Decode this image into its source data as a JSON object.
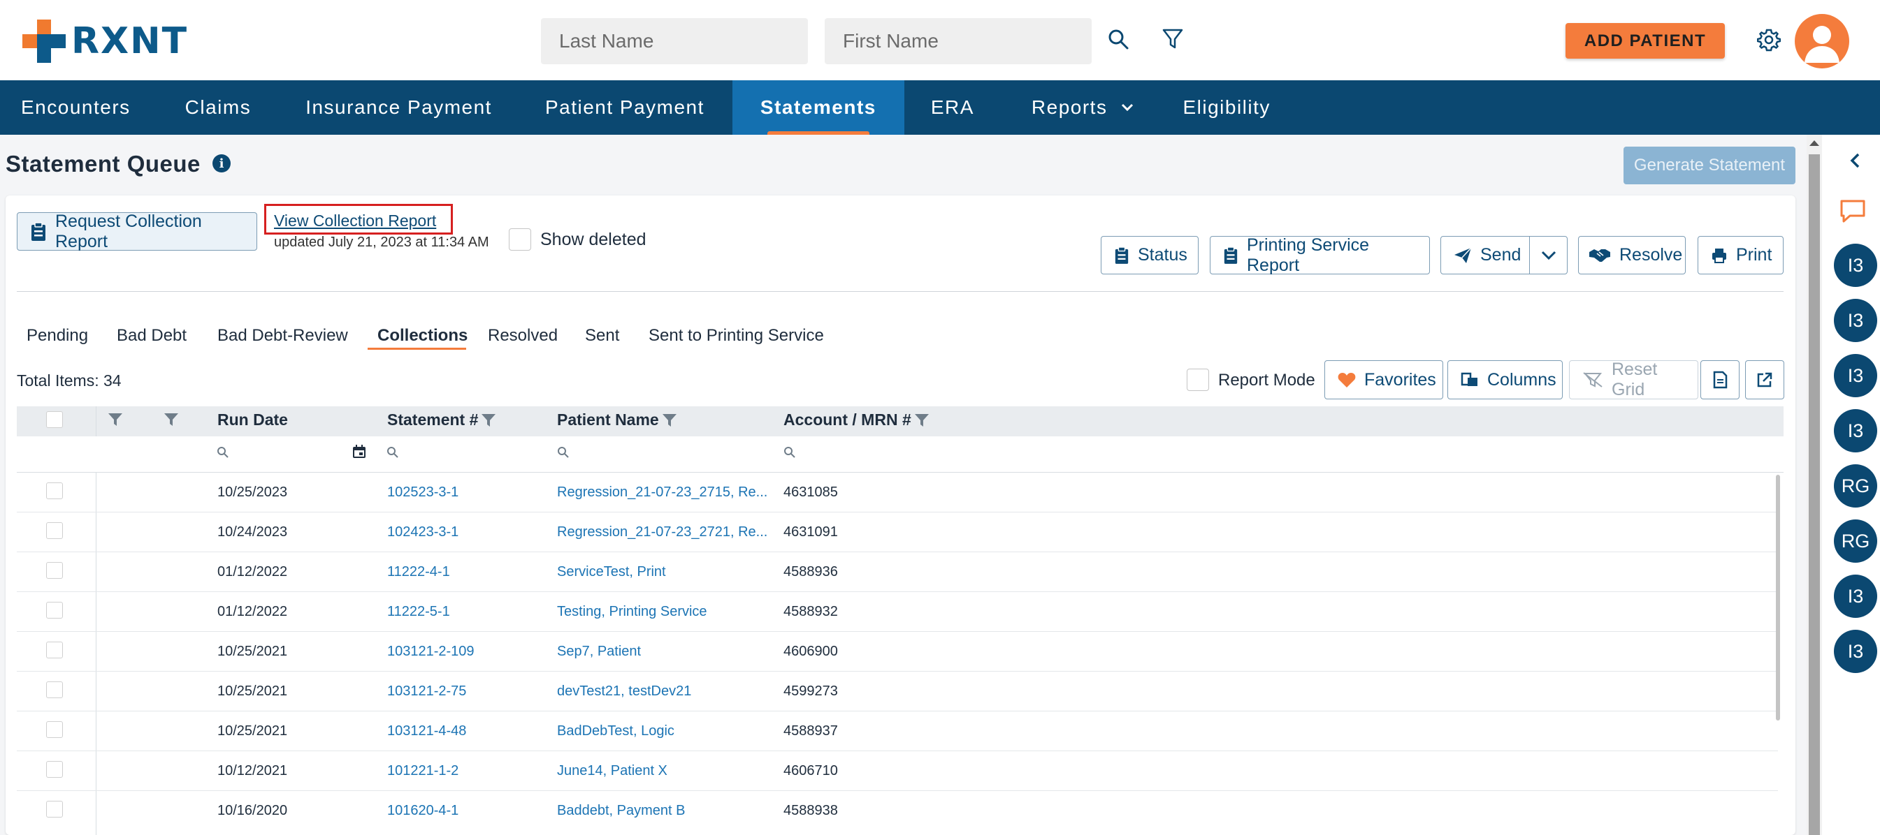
{
  "header": {
    "logo_text": "RXNT",
    "last_name_placeholder": "Last Name",
    "first_name_placeholder": "First Name",
    "add_patient": "ADD PATIENT"
  },
  "nav": {
    "items": [
      "Encounters",
      "Claims",
      "Insurance Payment",
      "Patient Payment",
      "Statements",
      "ERA",
      "Reports",
      "Eligibility"
    ],
    "active": "Statements"
  },
  "page": {
    "title": "Statement Queue",
    "generate_button": "Generate Statement"
  },
  "toolbar": {
    "request_collection": "Request Collection Report",
    "view_collection": "View Collection Report",
    "updated": "updated July 21, 2023 at 11:34 AM",
    "show_deleted": "Show deleted",
    "status": "Status",
    "printing_service_report": "Printing Service Report",
    "send": "Send",
    "resolve": "Resolve",
    "print": "Print"
  },
  "tabs": [
    "Pending",
    "Bad Debt",
    "Bad Debt-Review",
    "Collections",
    "Resolved",
    "Sent",
    "Sent to Printing Service"
  ],
  "active_tab": "Collections",
  "grid_toolbar": {
    "total_items": "Total Items: 34",
    "report_mode": "Report Mode",
    "favorites": "Favorites",
    "columns": "Columns",
    "reset_grid": "Reset Grid"
  },
  "grid": {
    "columns": [
      "Run Date",
      "Statement #",
      "Patient Name",
      "Account / MRN #"
    ],
    "rows": [
      {
        "run_date": "10/25/2023",
        "statement": "102523-3-1",
        "patient": "Regression_21-07-23_2715, Re...",
        "account": "4631085"
      },
      {
        "run_date": "10/24/2023",
        "statement": "102423-3-1",
        "patient": "Regression_21-07-23_2721, Re...",
        "account": "4631091"
      },
      {
        "run_date": "01/12/2022",
        "statement": "11222-4-1",
        "patient": "ServiceTest, Print",
        "account": "4588936"
      },
      {
        "run_date": "01/12/2022",
        "statement": "11222-5-1",
        "patient": "Testing, Printing Service",
        "account": "4588932"
      },
      {
        "run_date": "10/25/2021",
        "statement": "103121-2-109",
        "patient": "Sep7, Patient",
        "account": "4606900"
      },
      {
        "run_date": "10/25/2021",
        "statement": "103121-2-75",
        "patient": "devTest21, testDev21",
        "account": "4599273"
      },
      {
        "run_date": "10/25/2021",
        "statement": "103121-4-48",
        "patient": "BadDebTest, Logic",
        "account": "4588937"
      },
      {
        "run_date": "10/12/2021",
        "statement": "101221-1-2",
        "patient": "June14, Patient X",
        "account": "4606710"
      },
      {
        "run_date": "10/16/2020",
        "statement": "101620-4-1",
        "patient": "Baddebt, Payment B",
        "account": "4588938"
      }
    ]
  },
  "right_panel": {
    "bubbles": [
      "I3",
      "I3",
      "I3",
      "I3",
      "RG",
      "RG",
      "I3",
      "I3"
    ]
  },
  "colors": {
    "brand_blue": "#0b4871",
    "accent_orange": "#f47c3c",
    "link_blue": "#1c74b4"
  }
}
